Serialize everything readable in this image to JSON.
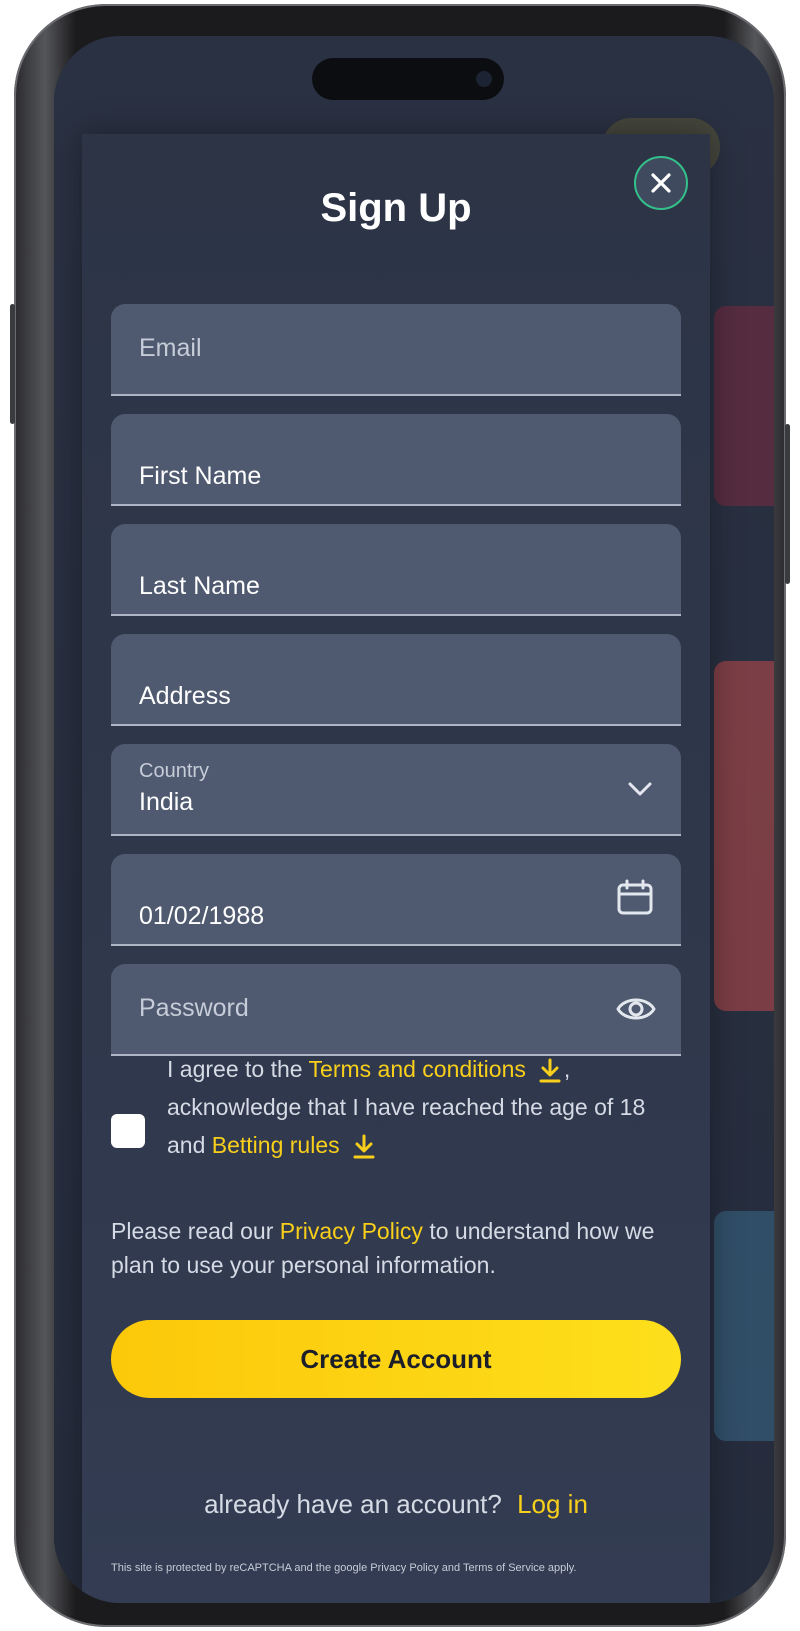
{
  "modal": {
    "title": "Sign Up",
    "fields": {
      "email": {
        "placeholder": "Email"
      },
      "first_name": {
        "value": "First Name"
      },
      "last_name": {
        "value": "Last Name"
      },
      "address": {
        "value": "Address"
      },
      "country": {
        "label": "Country",
        "value": "India"
      },
      "dob": {
        "value": "01/02/1988"
      },
      "password": {
        "placeholder": "Password"
      }
    },
    "agreement": {
      "text1": "I agree to the",
      "terms_link": "Terms and conditions",
      "text2": ",",
      "text3": "acknowledge that I have reached the age of 18 and",
      "betting_link": "Betting rules",
      "checked": false
    },
    "privacy": {
      "text1": "Please read our",
      "link": "Privacy Policy",
      "text2": "to understand how we plan to use your personal information."
    },
    "submit_label": "Create Account",
    "login_prompt": "already have an account?",
    "login_link": "Log in",
    "recaptcha_note": "This site is protected by reCAPTCHA and the google Privacy Policy and Terms of Service apply."
  },
  "colors": {
    "accent": "#f8cf1a",
    "modal_bg": "#2f374b",
    "field_bg": "#4f5a70",
    "close_border": "#34c08a"
  },
  "icons": [
    "close-icon",
    "chevron-down-icon",
    "calendar-icon",
    "eye-icon",
    "download-icon"
  ]
}
